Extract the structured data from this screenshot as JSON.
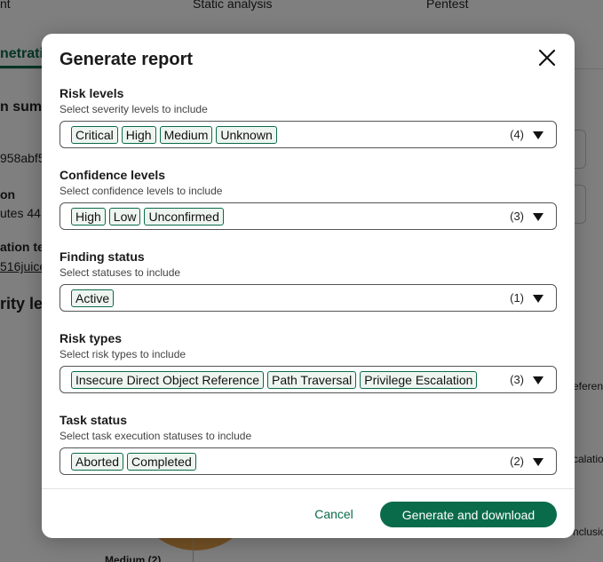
{
  "background": {
    "tabs": [
      "nt",
      "Static analysis",
      "Pentest"
    ],
    "active_tab_fragment": "netrati",
    "fragments": [
      "n summ",
      "958abf5",
      "on",
      "utes 44",
      "ation te",
      "516juice",
      "rity lev",
      "eference",
      "calation",
      "nclusion",
      "Medium (2)"
    ]
  },
  "modal": {
    "title": "Generate report",
    "sections": [
      {
        "label": "Risk levels",
        "help": "Select severity levels to include",
        "chips": [
          "Critical",
          "High",
          "Medium",
          "Unknown"
        ],
        "count": "(4)"
      },
      {
        "label": "Confidence levels",
        "help": "Select confidence levels to include",
        "chips": [
          "High",
          "Low",
          "Unconfirmed"
        ],
        "count": "(3)"
      },
      {
        "label": "Finding status",
        "help": "Select statuses to include",
        "chips": [
          "Active"
        ],
        "count": "(1)"
      },
      {
        "label": "Risk types",
        "help": "Select risk types to include",
        "chips": [
          "Insecure Direct Object Reference",
          "Path Traversal",
          "Privilege Escalation"
        ],
        "count": "(3)"
      },
      {
        "label": "Task status",
        "help": "Select task execution statuses to include",
        "chips": [
          "Aborted",
          "Completed"
        ],
        "count": "(2)"
      }
    ],
    "cancel_label": "Cancel",
    "submit_label": "Generate and download"
  },
  "colors": {
    "accent": "#0a6b4a",
    "chip_background": "#eef5f1",
    "overlay": "rgba(0,0,0,0.5)"
  },
  "icons": {
    "close": "close-icon",
    "dropdown": "chevron-down-icon"
  }
}
